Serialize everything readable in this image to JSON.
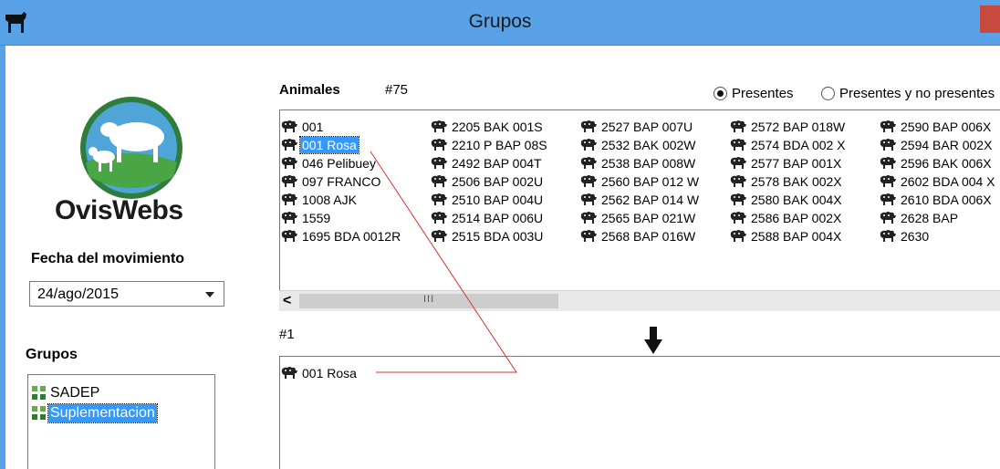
{
  "window": {
    "title": "Grupos"
  },
  "logo": {
    "text": "OvisWebs"
  },
  "fecha": {
    "label": "Fecha del movimiento",
    "value": "24/ago/2015"
  },
  "grupos": {
    "label": "Grupos",
    "items": [
      {
        "label": "SADEP",
        "selected": false
      },
      {
        "label": "Suplementacion",
        "selected": true
      }
    ]
  },
  "animales": {
    "label": "Animales",
    "count": "#75",
    "filter": {
      "presentes": "Presentes",
      "presentes_no": "Presentes y no presentes",
      "selected": "presentes"
    },
    "columns": [
      [
        "001",
        "001 Rosa",
        "046 Pelibuey",
        "097 FRANCO",
        "1008 AJK",
        "1559",
        "1695 BDA 0012R"
      ],
      [
        "2205 BAK 001S",
        "2210 P BAP 08S",
        "2492 BAP 004T",
        "2506 BAP 002U",
        "2510 BAP 004U",
        "2514 BAP 006U",
        "2515 BDA 003U"
      ],
      [
        "2527 BAP 007U",
        "2532 BAK 002W",
        "2538 BAP 008W",
        "2560 BAP 012 W",
        "2562 BAP 014 W",
        "2565 BAP 021W",
        "2568 BAP 016W"
      ],
      [
        "2572 BAP 018W",
        "2574 BDA 002 X",
        "2577 BAP 001X",
        "2578 BAK 002X",
        "2580 BAK 004X",
        "2586 BAP 002X",
        "2588 BAP 004X"
      ],
      [
        "2590 BAP 006X",
        "2594 BAR 002X",
        "2596 BAK 006X",
        "2602 BDA 004 X",
        "2610 BDA 006X",
        "2628 BAP",
        "2630"
      ]
    ],
    "selected": "001 Rosa"
  },
  "destino": {
    "count": "#1",
    "items": [
      "001 Rosa"
    ]
  },
  "colors": {
    "titlebar": "#5aa2e8",
    "selection": "#3399ff",
    "drag_line": "#e0302a"
  }
}
